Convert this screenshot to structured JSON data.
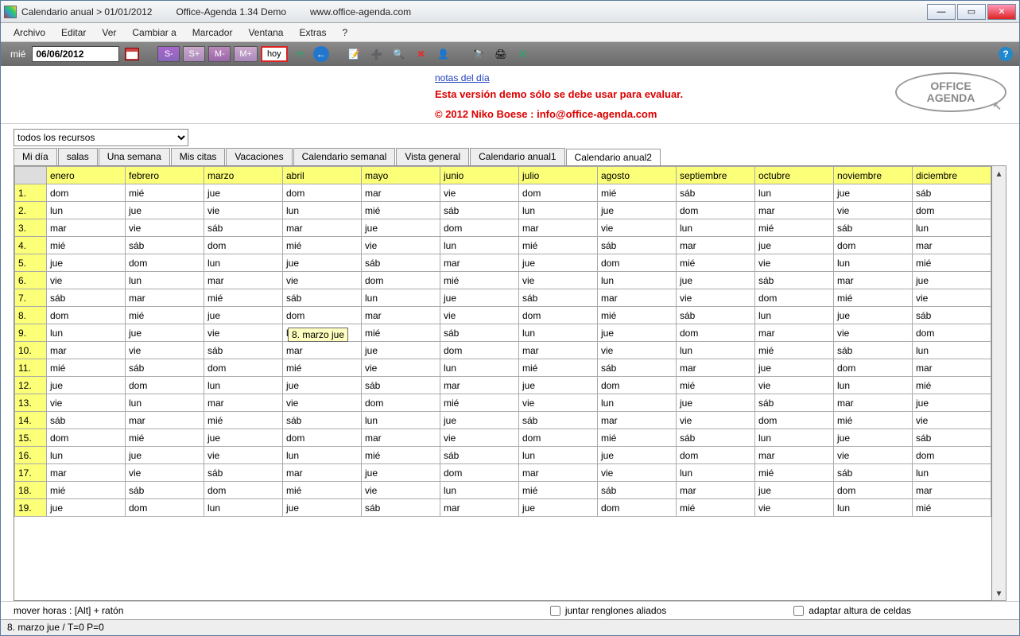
{
  "titlebar": {
    "text1": "Calendario anual > 01/01/2012",
    "text2": "Office-Agenda 1.34 Demo",
    "text3": "www.office-agenda.com"
  },
  "menubar": [
    "Archivo",
    "Editar",
    "Ver",
    "Cambiar a",
    "Marcador",
    "Ventana",
    "Extras",
    "?"
  ],
  "toolbar": {
    "day_label": "mié",
    "date": "06/06/2012",
    "sminus": "S-",
    "splus": "S+",
    "mminus": "M-",
    "mplus": "M+",
    "hoy": "hoy"
  },
  "info": {
    "notes_link": "notas del día",
    "demo": "Esta versión demo sólo se debe usar para evaluar.",
    "copyright": "© 2012 Niko Boese : info@office-agenda.com",
    "logo1": "OFFICE",
    "logo2": "AGENDA"
  },
  "resource": {
    "selected": "todos los recursos"
  },
  "tabs": [
    "Mi día",
    "salas",
    "Una semana",
    "Mis citas",
    "Vacaciones",
    "Calendario semanal",
    "Vista general",
    "Calendario anual1",
    "Calendario anual2"
  ],
  "active_tab": 8,
  "months": [
    "enero",
    "febrero",
    "marzo",
    "abril",
    "mayo",
    "junio",
    "julio",
    "agosto",
    "septiembre",
    "octubre",
    "noviembre",
    "diciembre"
  ],
  "start_day_index": [
    0,
    3,
    4,
    0,
    2,
    5,
    0,
    3,
    6,
    1,
    4,
    6
  ],
  "days": [
    "dom",
    "lun",
    "mar",
    "mié",
    "jue",
    "vie",
    "sáb"
  ],
  "row_count": 19,
  "tooltip": "8. marzo jue",
  "footer": {
    "hint": "mover horas : [Alt] + ratón",
    "check1": "juntar renglones aliados",
    "check2": "adaptar altura de celdas"
  },
  "statusbar": "8. marzo jue   / T=0  P=0"
}
